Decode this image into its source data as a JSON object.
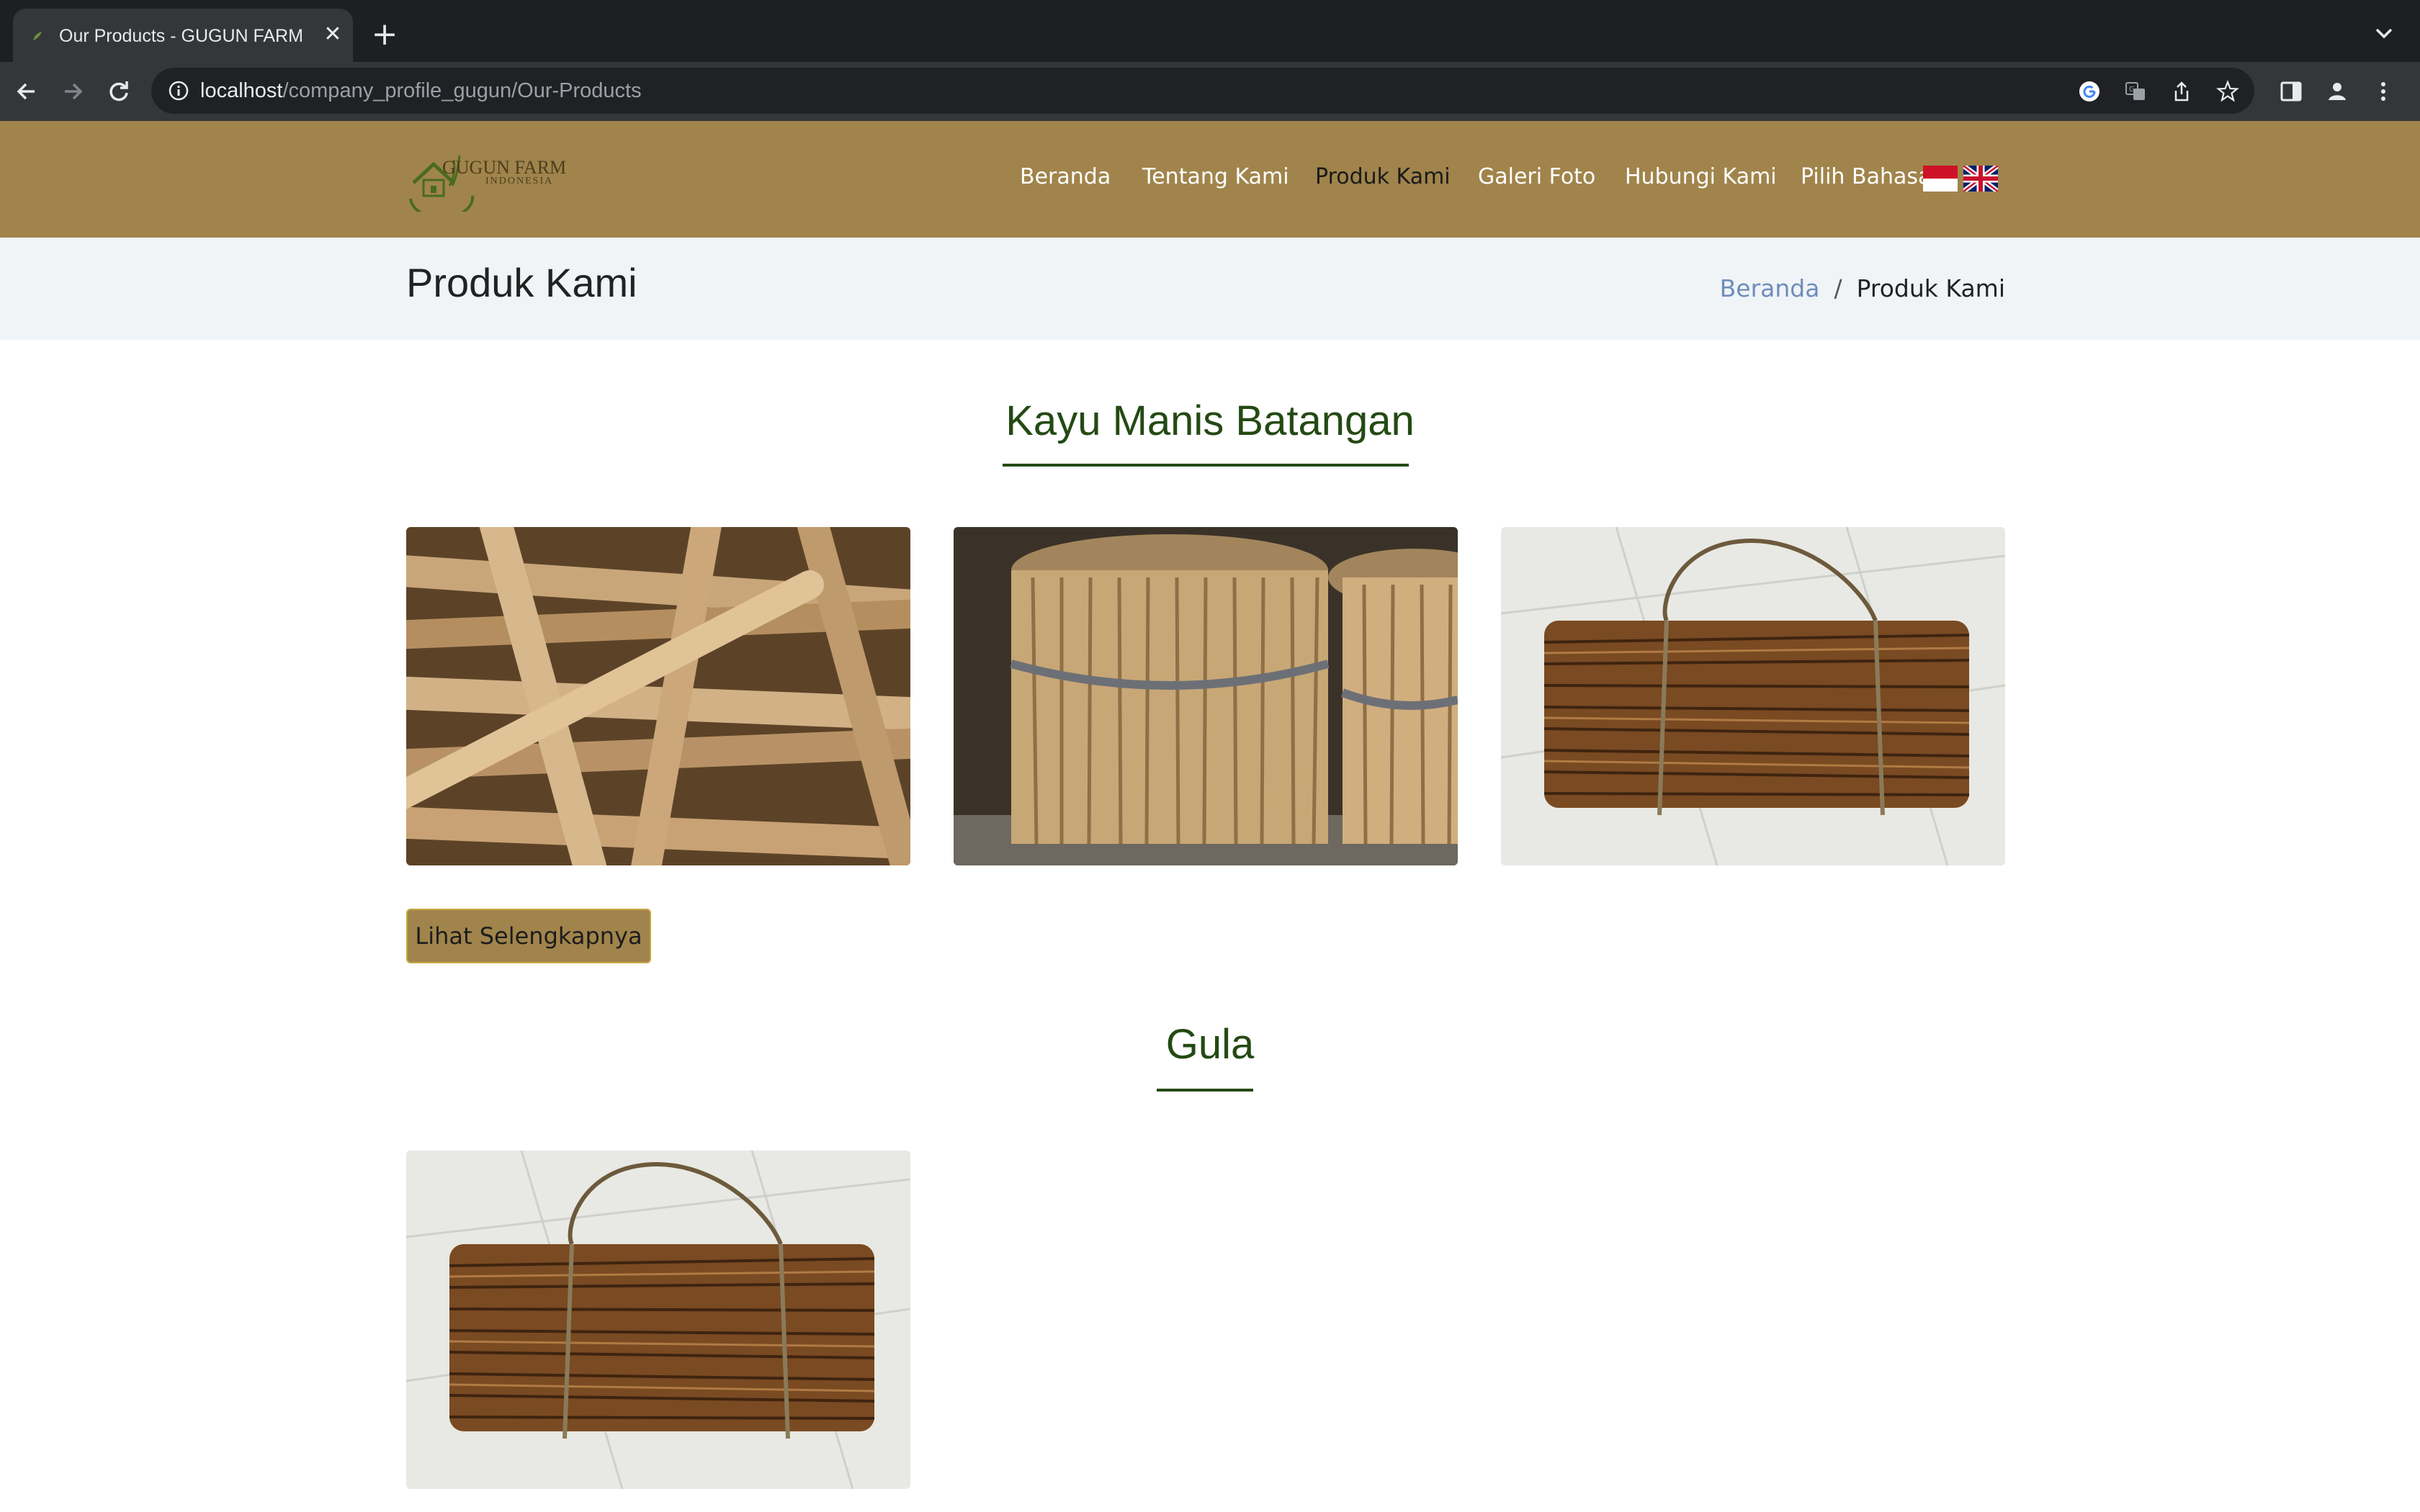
{
  "browser": {
    "tab_title": "Our Products - GUGUN FARM",
    "tab_close": "✕",
    "new_tab": "+",
    "url_host": "localhost",
    "url_path": "/company_profile_gugun/Our-Products"
  },
  "header": {
    "logo_text": "GUGUN FARM",
    "logo_subtext": "INDONESIA",
    "nav": [
      "Beranda",
      "Tentang Kami",
      "Produk Kami",
      "Galeri Foto",
      "Hubungi Kami",
      "Pilih Bahasa"
    ],
    "active_nav": "Produk Kami"
  },
  "breadcrumb": {
    "title": "Produk Kami",
    "home": "Beranda",
    "separator": "/",
    "current": "Produk Kami"
  },
  "sections": [
    {
      "title": "Kayu Manis Batangan",
      "button_label": "Lihat Selengkapnya"
    },
    {
      "title": "Gula"
    }
  ],
  "colors": {
    "header_bg": "#a0844b",
    "section_title": "#244a14",
    "breadcrumb_link": "#6f8dbb"
  }
}
